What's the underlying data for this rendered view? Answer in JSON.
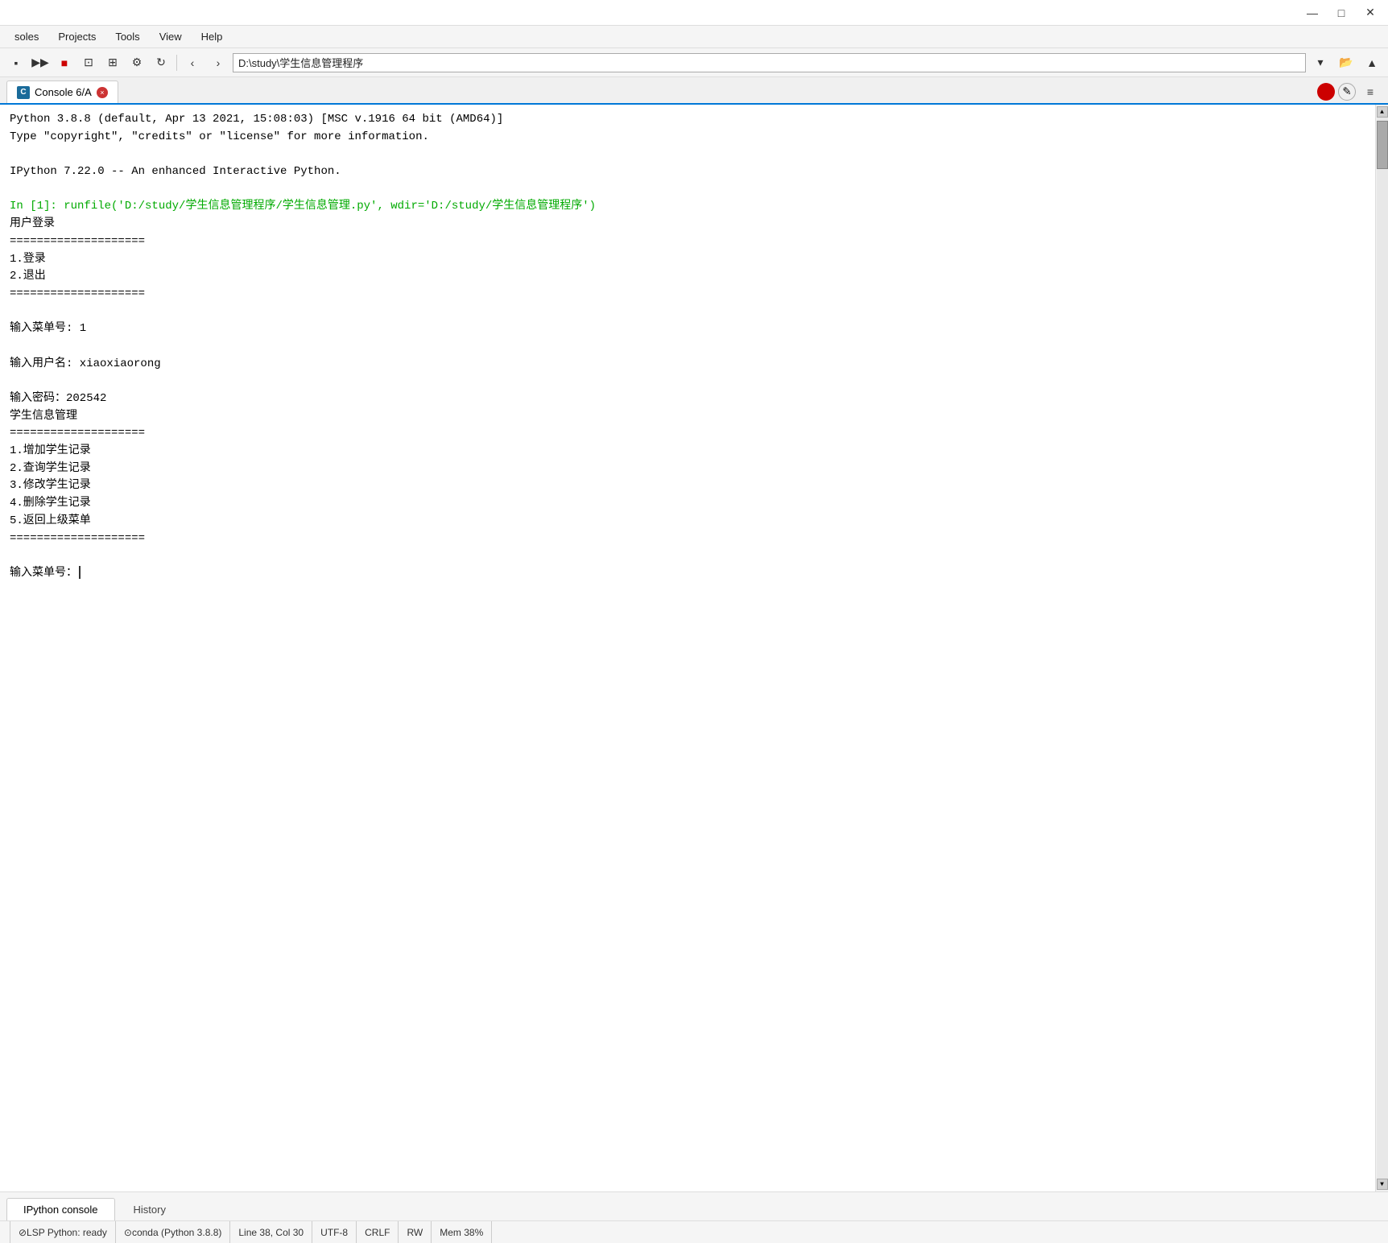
{
  "titlebar": {
    "minimize_label": "—",
    "maximize_label": "□",
    "close_label": "✕"
  },
  "menubar": {
    "items": [
      {
        "label": "soles"
      },
      {
        "label": "Projects"
      },
      {
        "label": "Tools"
      },
      {
        "label": "View"
      },
      {
        "label": "Help"
      }
    ]
  },
  "toolbar": {
    "buttons": [
      "▪",
      "▶▶",
      "■",
      "⊡",
      "⊞"
    ],
    "nav": {
      "back": "‹",
      "forward": "›",
      "address": "D:\\study\\学生信息管理程序"
    }
  },
  "tab": {
    "icon_label": "C",
    "label": "Console 6/A",
    "close_symbol": "×"
  },
  "console": {
    "line1": "Python 3.8.8 (default, Apr 13 2021, 15:08:03) [MSC v.1916 64 bit (AMD64)]",
    "line2": "Type \"copyright\", \"credits\" or \"license\" for more information.",
    "line3": "",
    "line4": "IPython 7.22.0 -- An enhanced Interactive Python.",
    "line5": "",
    "in_prompt": "In [1]: ",
    "run_cmd": "runfile('D:/study/学生信息管理程序/学生信息管理.py', wdir='D:/study/学生信息管理程序')",
    "output": [
      "用户登录",
      "====================",
      "1.登录",
      "2.退出",
      "====================",
      "",
      "输入菜单号: 1",
      "",
      "输入用户名: xiaoxiaorong",
      "",
      "输入密码：202542",
      "学生信息管理",
      "====================",
      "1.增加学生记录",
      "2.查询学生记录",
      "3.修改学生记录",
      "4.删除学生记录",
      "5.返回上级菜单",
      "====================",
      "",
      "输入菜单号："
    ]
  },
  "bottom_tabs": {
    "tab1": "IPython console",
    "tab2": "History"
  },
  "statusbar": {
    "lsp": "⊘LSP Python: ready",
    "conda": "⊙conda (Python 3.8.8)",
    "line_col": "Line 38, Col 30",
    "encoding": "UTF-8",
    "line_ending": "CRLF",
    "rw": "RW",
    "mem": "Mem 38%"
  }
}
